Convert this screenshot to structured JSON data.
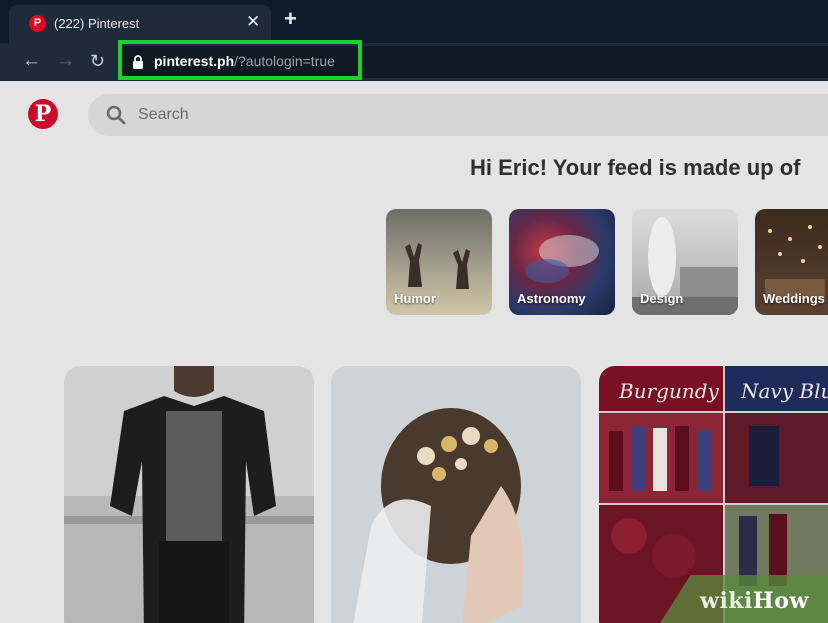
{
  "browser": {
    "tab": {
      "title": "(222) Pinterest",
      "favicon": "pinterest-icon"
    },
    "url": {
      "host": "pinterest.ph",
      "path": "/?autologin=true"
    }
  },
  "pinterest": {
    "search_placeholder": "Search",
    "greeting": "Hi Eric! Your feed is made up of",
    "topics": [
      {
        "label": "Humor"
      },
      {
        "label": "Astronomy"
      },
      {
        "label": "Design"
      },
      {
        "label": "Weddings"
      }
    ],
    "pins": [
      {
        "subject": "man in denim jacket"
      },
      {
        "subject": "bridal hair accessory"
      },
      {
        "subject": "burgundy and navy blue wedding collage",
        "captions": [
          "Burgundy",
          "Navy Blu"
        ]
      }
    ]
  },
  "watermark": {
    "wiki": "wiki",
    "how": "How"
  },
  "colors": {
    "highlight": "#19d130",
    "pinterest_red": "#e60023"
  }
}
